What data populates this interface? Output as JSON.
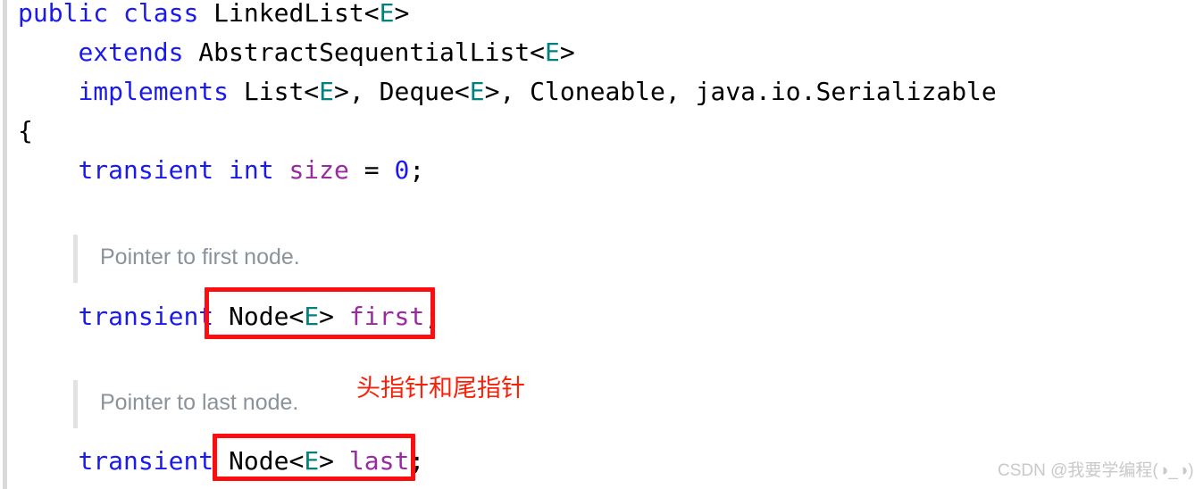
{
  "editor": {
    "language": "java",
    "background_color": "#ffffff",
    "gutter_color": "#d9d9d9",
    "colors": {
      "keyword": "#1a1aee",
      "generic_type": "#00807e",
      "field_identifier": "#9a2aa0",
      "number": "#1a1aee",
      "plain_text": "#000000",
      "doc_comment": "#8a939b",
      "doc_bar": "#e2e2e2",
      "annotation_red": "#fd0d0d",
      "chinese_annotation": "#fa2008",
      "watermark": "#c9c9c9"
    }
  },
  "code": {
    "lines": [
      {
        "id": "line-class-declaration",
        "tokens": [
          {
            "text": "public",
            "style": "kw"
          },
          {
            "text": " ",
            "style": "plain"
          },
          {
            "text": "class",
            "style": "kw"
          },
          {
            "text": " LinkedList<",
            "style": "plain"
          },
          {
            "text": "E",
            "style": "gen"
          },
          {
            "text": ">",
            "style": "plain"
          }
        ]
      },
      {
        "id": "line-extends",
        "tokens": [
          {
            "text": "    ",
            "style": "plain"
          },
          {
            "text": "extends",
            "style": "kw"
          },
          {
            "text": " AbstractSequentialList<",
            "style": "plain"
          },
          {
            "text": "E",
            "style": "gen"
          },
          {
            "text": ">",
            "style": "plain"
          }
        ]
      },
      {
        "id": "line-implements",
        "tokens": [
          {
            "text": "    ",
            "style": "plain"
          },
          {
            "text": "implements",
            "style": "kw"
          },
          {
            "text": " List<",
            "style": "plain"
          },
          {
            "text": "E",
            "style": "gen"
          },
          {
            "text": ">, Deque<",
            "style": "plain"
          },
          {
            "text": "E",
            "style": "gen"
          },
          {
            "text": ">, Cloneable, java.io.Serializable",
            "style": "plain"
          }
        ]
      },
      {
        "id": "line-open-brace",
        "tokens": [
          {
            "text": "{",
            "style": "plain"
          }
        ]
      },
      {
        "id": "line-size-field",
        "tokens": [
          {
            "text": "    ",
            "style": "plain"
          },
          {
            "text": "transient",
            "style": "kw"
          },
          {
            "text": " ",
            "style": "plain"
          },
          {
            "text": "int",
            "style": "kw"
          },
          {
            "text": " ",
            "style": "plain"
          },
          {
            "text": "size",
            "style": "fld"
          },
          {
            "text": " = ",
            "style": "plain"
          },
          {
            "text": "0",
            "style": "num"
          },
          {
            "text": ";",
            "style": "plain"
          }
        ]
      },
      {
        "id": "line-first-field",
        "tokens": [
          {
            "text": "    ",
            "style": "plain"
          },
          {
            "text": "transient",
            "style": "kw"
          },
          {
            "text": " Node<",
            "style": "plain"
          },
          {
            "text": "E",
            "style": "gen"
          },
          {
            "text": "> ",
            "style": "plain"
          },
          {
            "text": "first",
            "style": "fld"
          },
          {
            "text": ";",
            "style": "plain"
          }
        ]
      },
      {
        "id": "line-last-field",
        "tokens": [
          {
            "text": "    ",
            "style": "plain"
          },
          {
            "text": "transient",
            "style": "kw"
          },
          {
            "text": " Node<",
            "style": "plain"
          },
          {
            "text": "E",
            "style": "gen"
          },
          {
            "text": "> ",
            "style": "plain"
          },
          {
            "text": "last",
            "style": "fld"
          },
          {
            "text": ";",
            "style": "plain"
          }
        ]
      }
    ]
  },
  "doc_comments": [
    {
      "id": "doc-first",
      "text": "Pointer to first node."
    },
    {
      "id": "doc-last",
      "text": "Pointer to last node."
    }
  ],
  "annotations": {
    "chinese_note": "头指针和尾指针",
    "highlight_boxes": [
      {
        "id": "redbox-first",
        "encloses": "Node<E> first;"
      },
      {
        "id": "redbox-last",
        "encloses": "Node<E> last;"
      }
    ]
  },
  "watermark": {
    "text": "CSDN @我要学编程(◑_◑)"
  }
}
